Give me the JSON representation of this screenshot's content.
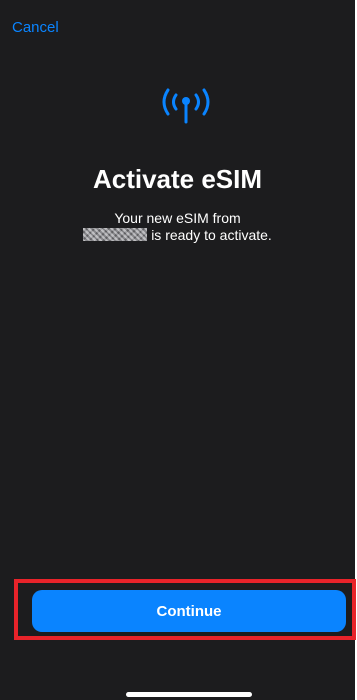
{
  "nav": {
    "cancel_label": "Cancel"
  },
  "main": {
    "icon": "antenna-radiowaves-icon",
    "title": "Activate eSIM",
    "subtitle_line1": "Your new eSIM from",
    "subtitle_line2": "is ready to activate."
  },
  "footer": {
    "continue_label": "Continue"
  },
  "colors": {
    "accent": "#0a84ff",
    "background": "#1c1c1e",
    "highlight": "#e8232a"
  }
}
